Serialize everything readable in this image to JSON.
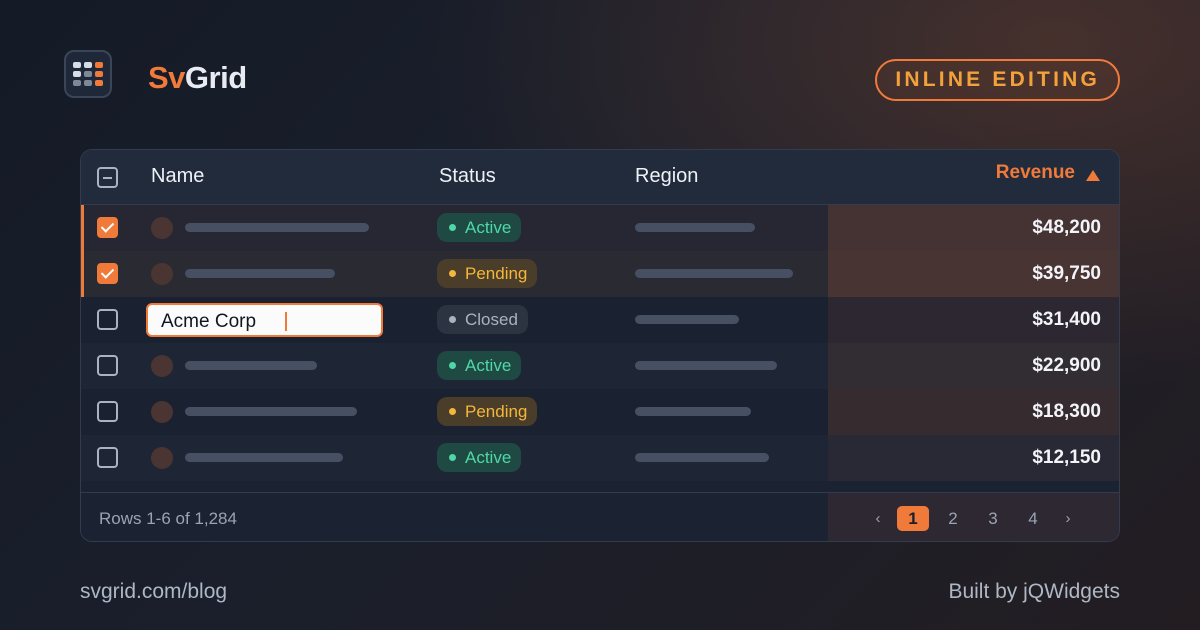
{
  "brand": {
    "prefix": "Sv",
    "suffix": "Grid",
    "logo_icon": "grid-table-icon"
  },
  "badge": {
    "label": "INLINE EDITING"
  },
  "colors": {
    "accent": "#f07a3a",
    "active": "#4fd8a6",
    "pending": "#f4b73a",
    "closed": "#a9b2c0"
  },
  "table": {
    "columns": [
      {
        "key": "name",
        "label": "Name"
      },
      {
        "key": "status",
        "label": "Status"
      },
      {
        "key": "region",
        "label": "Region"
      },
      {
        "key": "revenue",
        "label": "Revenue",
        "sorted": "ascending"
      }
    ],
    "rows": [
      {
        "selected": true,
        "status": "Active",
        "revenue": "$48,200"
      },
      {
        "selected": true,
        "status": "Pending",
        "revenue": "$39,750"
      },
      {
        "selected": false,
        "editing": true,
        "name_value": "Acme Corp",
        "status": "Closed",
        "revenue": "$31,400"
      },
      {
        "selected": false,
        "status": "Active",
        "revenue": "$22,900"
      },
      {
        "selected": false,
        "status": "Pending",
        "revenue": "$18,300"
      },
      {
        "selected": false,
        "status": "Active",
        "revenue": "$12,150"
      }
    ],
    "footer": {
      "rows_info": "Rows 1-6 of 1,284",
      "prev": "‹",
      "pages": [
        "1",
        "2",
        "3",
        "4"
      ],
      "current_page": "1",
      "next": "›"
    }
  },
  "footer": {
    "left": "svgrid.com/blog",
    "right": "Built by jQWidgets"
  }
}
